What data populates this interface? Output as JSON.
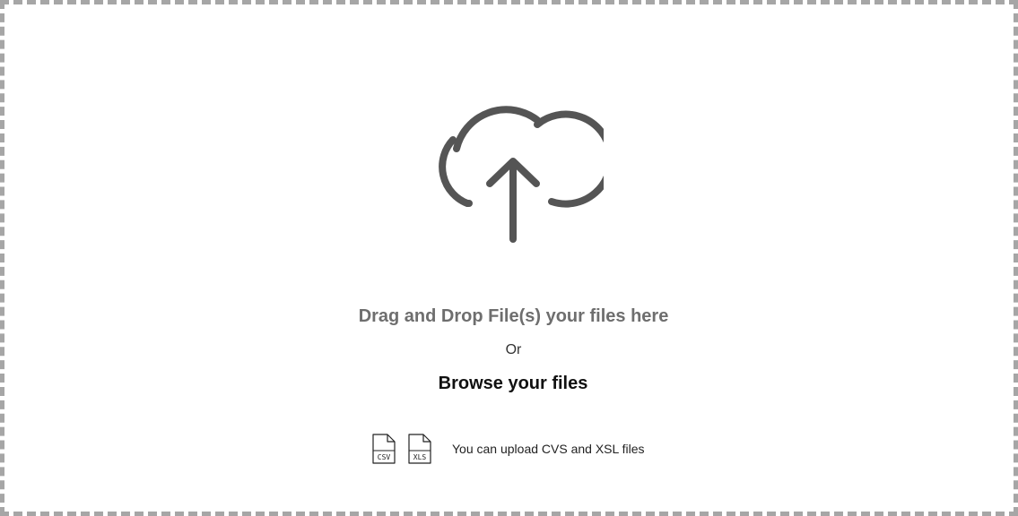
{
  "upload": {
    "icon": "cloud-upload-icon",
    "headline": "Drag and Drop File(s) your files here",
    "separator": "Or",
    "browse_label": "Browse your files",
    "hint": "You can upload CVS and XSL files",
    "file_types": [
      {
        "label": "CSV",
        "icon": "csv-file-icon"
      },
      {
        "label": "XLS",
        "icon": "xls-file-icon"
      }
    ]
  },
  "colors": {
    "border": "#a6a6a6",
    "icon": "#555555",
    "headline": "#6e6e6e",
    "text": "#222222"
  }
}
